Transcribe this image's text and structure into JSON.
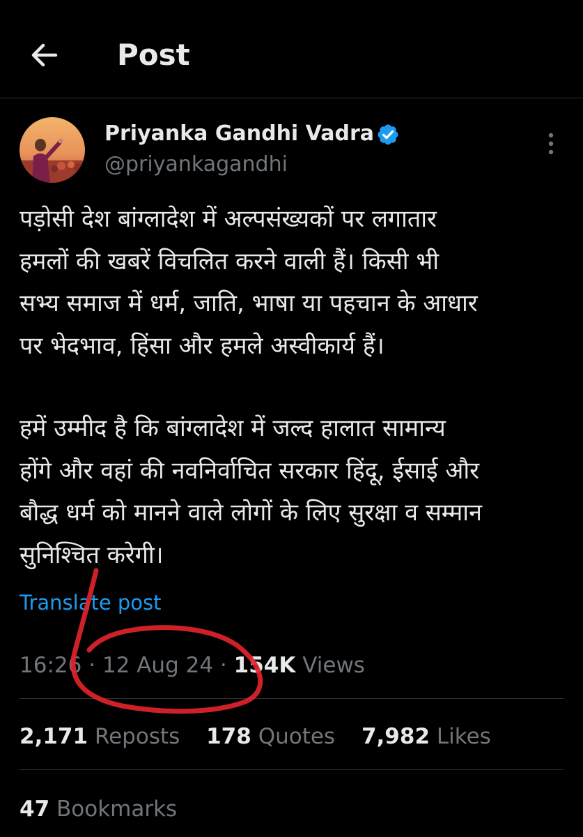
{
  "header": {
    "title": "Post",
    "back_icon": "arrow-left-icon"
  },
  "author": {
    "name": "Priyanka Gandhi Vadra",
    "handle": "@priyankagandhi",
    "verified_icon": "verified-badge-icon",
    "verified_color": "#1d9bf0"
  },
  "post": {
    "paragraph_1": "पड़ोसी देश बांग्लादेश में अल्पसंख्यकों पर लगातार\nहमलों की खबरें विचलित करने वाली हैं। किसी भी\nसभ्य समाज में धर्म, जाति, भाषा या पहचान के आधार\nपर भेदभाव, हिंसा और हमले अस्वीकार्य हैं।",
    "paragraph_2": "हमें उम्मीद है कि बांग्लादेश में जल्द हालात सामान्य\nहोंगे और वहां की नवनिर्वाचित सरकार हिंदू, ईसाई और\nबौद्ध धर्म को मानने वाले लोगों के लिए सुरक्षा व सम्मान\nसुनिश्चित करेगी।",
    "translate_label": "Translate post"
  },
  "meta": {
    "time": "16:26",
    "date": "12 Aug 24",
    "separator": "·",
    "views_count": "154K",
    "views_label": "Views"
  },
  "stats": {
    "reposts_count": "2,171",
    "reposts_label": "Reposts",
    "quotes_count": "178",
    "quotes_label": "Quotes",
    "likes_count": "7,982",
    "likes_label": "Likes"
  },
  "bookmarks": {
    "count": "47",
    "label": "Bookmarks"
  },
  "colors": {
    "background": "#000000",
    "text": "#e7e9ea",
    "muted": "#71767b",
    "link": "#1d9bf0",
    "divider": "#2f3336",
    "annotation": "#e0242a"
  }
}
